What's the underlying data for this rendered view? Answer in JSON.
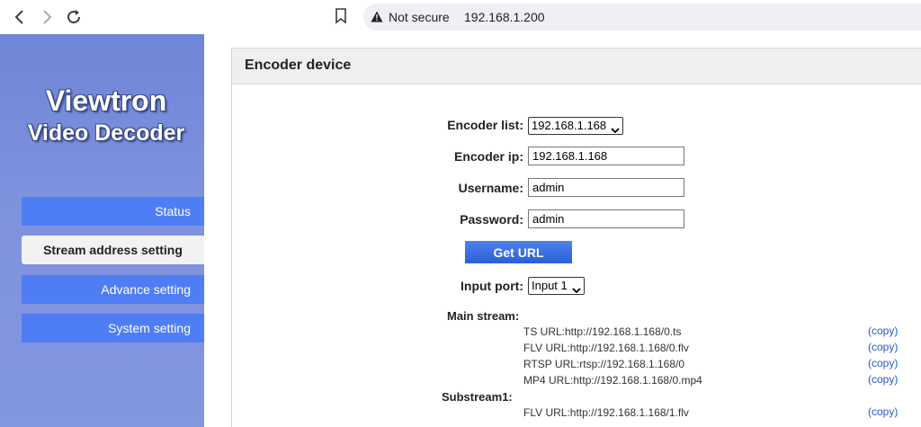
{
  "browser": {
    "security_label": "Not secure",
    "address": "192.168.1.200"
  },
  "sidebar": {
    "brand_line1": "Viewtron",
    "brand_line2": "Video Decoder",
    "items": [
      {
        "label": "Status"
      },
      {
        "label": "Stream address setting"
      },
      {
        "label": "Advance setting"
      },
      {
        "label": "System setting"
      }
    ]
  },
  "panel": {
    "title": "Encoder device",
    "encoder_list": {
      "label": "Encoder list:",
      "selected": "192.168.1.168"
    },
    "encoder_ip": {
      "label": "Encoder ip:",
      "value": "192.168.1.168"
    },
    "username": {
      "label": "Username:",
      "value": "admin"
    },
    "password": {
      "label": "Password:",
      "value": "admin"
    },
    "get_url_label": "Get URL",
    "input_port": {
      "label": "Input port:",
      "selected": "Input 1"
    },
    "main_stream": {
      "label": "Main stream:",
      "urls": [
        {
          "text": "TS URL:http://192.168.1.168/0.ts",
          "copy": "(copy)"
        },
        {
          "text": "FLV URL:http://192.168.1.168/0.flv",
          "copy": "(copy)"
        },
        {
          "text": "RTSP URL:rtsp://192.168.1.168/0",
          "copy": "(copy)"
        },
        {
          "text": "MP4 URL:http://192.168.1.168/0.mp4",
          "copy": "(copy)"
        }
      ]
    },
    "substream": {
      "label": "Substream1:",
      "urls": [
        {
          "text": "FLV URL:http://192.168.1.168/1.flv",
          "copy": "(copy)"
        }
      ]
    }
  },
  "colors": {
    "sidebar_bg": "#7f92de",
    "menu_button": "#4f7df3",
    "link": "#2557c7"
  }
}
